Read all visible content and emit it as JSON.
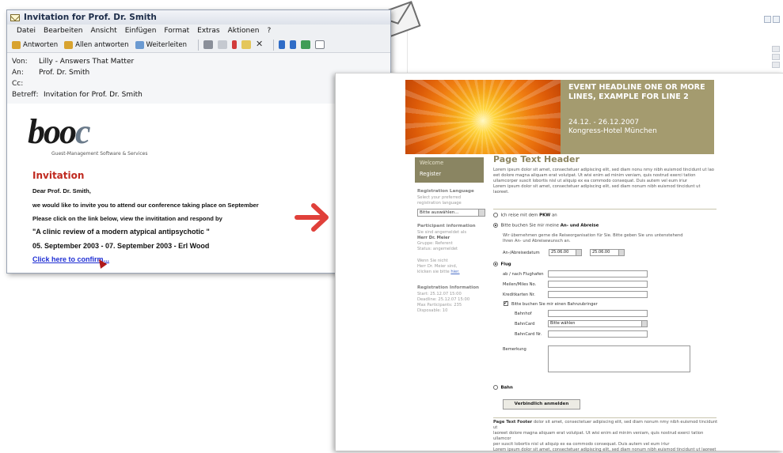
{
  "email": {
    "title": "Invitation for Prof. Dr. Smith",
    "menu": [
      "Datei",
      "Bearbeiten",
      "Ansicht",
      "Einfügen",
      "Format",
      "Extras",
      "Aktionen",
      "?"
    ],
    "toolbar": {
      "reply": "Antworten",
      "reply_all": "Allen antworten",
      "forward": "Weiterleiten"
    },
    "headers": {
      "from_label": "Von:",
      "from": "Lilly - Answers That Matter",
      "to_label": "An:",
      "to": "Prof. Dr. Smith",
      "cc_label": "Cc:",
      "cc": "",
      "subject_label": "Betreff:",
      "subject": "Invitation for Prof. Dr. Smith"
    },
    "logo": "booc",
    "tagline": "Guest-Management Software & Services",
    "heading": "Invitation",
    "greeting": "Dear Prof. Dr. Smith,",
    "line1": "we would like to invite you to attend our conference taking place on September",
    "line2": "Please click on the link below, view the  invititation and respond by",
    "topic": "\"A clinic review of a modern atypical antipsychotic \"",
    "date_line": "05. September 2003 - 07. September 2003 - Erl Wood",
    "link": "Click here to confirm..."
  },
  "registration": {
    "headline": "EVENT HEADLINE ONE OR MORE LINES, EXAMPLE FOR LINE 2",
    "dates": "24.12. - 26.12.2007",
    "venue": "Kongress-Hotel München",
    "nav": [
      "Welcome",
      "Register"
    ],
    "sidebar": {
      "lang_head": "Registration Language",
      "lang_text": "Select your preferred registration language",
      "lang_select": "Bitte auswählen...",
      "participant_head": "Participant information",
      "participant_l1": "Sie sind angemeldet als",
      "participant_name": "Herr Dr. Meier",
      "participant_l3": "Gruppe: Referent",
      "participant_l4": "Status: angemeldet",
      "not_you_1": "Wenn Sie nicht",
      "not_you_2": "Herr Dr. Meier sind,",
      "not_you_3": "klicken sie bitte",
      "not_you_link": "hier.",
      "reginfo_head": "Registration Information",
      "reginfo_1": "Start: 25.12.07 15:00",
      "reginfo_2": "Deadline: 25.12.07 15:00",
      "reginfo_3": "Max Participants: 235",
      "reginfo_4": "Disposable: 10"
    },
    "page_header": "Page Text Header",
    "lorem_1": "Lorem ipsum dolor sit amet, consectetuer adipiscing elit, sed diam nonu nmy nibh euismod tincidunt ut lao eet dolore magna aliquam erat volutpat. Ut wisi enim ad minim veniam, quis nostrud exerci tation ullamcorper suscit lobortis nisl ut aliquip ex ea commodo consequat. Duis autem vel eum iriur",
    "lorem_2": "Lorem ipsum dolor sit amet, consectetuer adipiscing elit, sed diam nonum nibh euismod tincidunt ut laoreet.",
    "opt_pkw": "Ich reise mit dem",
    "opt_pkw_b": "PKW",
    "opt_pkw_tail": "an",
    "opt_travel": "Bitte buchen Sie mir meine",
    "opt_travel_b": "An- und Abreise",
    "travel_desc_1": "Wir übernehmen gerne die Reiseorganisation für Sie. Bitte geben Sie uns untenstehend",
    "travel_desc_2": "Ihren An- und Abreisewunsch an.",
    "date_label": "An-/Abreisedatum",
    "date_from": "25.06.00",
    "date_to": "25.06.00",
    "opt_flight": "Flug",
    "airport_label": "ab / nach Flughafen",
    "miles_label": "Meilen/Miles No.",
    "card_label": "Kreditkarten Nr.",
    "train_check": "Bitte buchen Sie mir einen Bahnzubringer",
    "station_label": "Bahnhof",
    "bahncard_label": "BahnCard",
    "bahncard_select": "Bitte wählen",
    "bahncard_no_label": "BahnCard Nr.",
    "remark_label": "Bemerkung",
    "opt_train": "Bahn",
    "submit": "Verbindlich anmelden",
    "footer_head": "Page Text Footer",
    "footer_1": "dolor sit amet, consectetuer adipiscing elit, sed diam nonum nmy nibh euismod tincidunt ut",
    "footer_2": "laoreet dolore magna aliquam erat volutpat. Ut wisi enim ad minim veniam, quis nostrud exerci tation ullamcor",
    "footer_3": "per suscit lobortis nisl ut aliquip ex ea commodo consequat. Duis autem vel eum iriur",
    "footer_4": "Lorem ipsum dolor sit amet, consectetuer adipiscing elit, sed diam nonum nibh euismod tincidunt ut laoreet"
  },
  "colors": {
    "accent": "#a49b6f",
    "invitation_red": "#c0291f",
    "link_blue": "#1f2fd4",
    "arrow": "#e0403a"
  }
}
